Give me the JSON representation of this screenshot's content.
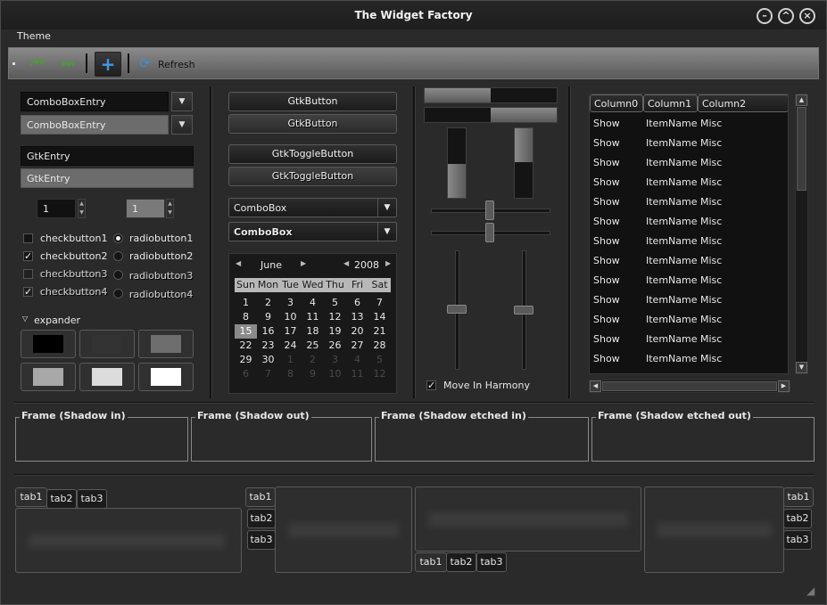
{
  "window": {
    "title": "The Widget Factory"
  },
  "menubar": {
    "theme_label": "Theme"
  },
  "toolbar": {
    "refresh_label": "Refresh"
  },
  "left": {
    "combo_entry_1": "ComboBoxEntry",
    "combo_entry_2": "ComboBoxEntry",
    "entry_1": "GtkEntry",
    "entry_2": "GtkEntry",
    "spin_1": "1",
    "spin_2": "1",
    "checks": [
      {
        "label": "checkbutton1",
        "checked": false
      },
      {
        "label": "checkbutton2",
        "checked": true
      },
      {
        "label": "checkbutton3",
        "checked": false
      },
      {
        "label": "checkbutton4",
        "checked": false
      }
    ],
    "radios": [
      {
        "label": "radiobutton1",
        "selected": true
      },
      {
        "label": "radiobutton2",
        "selected": false
      },
      {
        "label": "radiobutton3",
        "selected": false
      },
      {
        "label": "radiobutton4",
        "selected": false
      }
    ],
    "expander_label": "expander",
    "swatches": [
      "#000000",
      "#333333",
      "#6e6e6e",
      "#a8a8a8",
      "#dcdcdc",
      "#ffffff"
    ]
  },
  "middle": {
    "button_1": "GtkButton",
    "button_2": "GtkButton",
    "toggle_1": "GtkToggleButton",
    "toggle_2": "GtkToggleButton",
    "combo_1": "ComboBox",
    "combo_2": "ComboBox",
    "calendar": {
      "month": "June",
      "year": "2008",
      "day_names": [
        "Sun",
        "Mon",
        "Tue",
        "Wed",
        "Thu",
        "Fri",
        "Sat"
      ],
      "days": [
        "1",
        "2",
        "3",
        "4",
        "5",
        "6",
        "7",
        "8",
        "9",
        "10",
        "11",
        "12",
        "13",
        "14",
        "15",
        "16",
        "17",
        "18",
        "19",
        "20",
        "21",
        "22",
        "23",
        "24",
        "25",
        "26",
        "27",
        "28",
        "29",
        "30",
        "1",
        "2",
        "3",
        "4",
        "5",
        "6",
        "7",
        "8",
        "9",
        "10",
        "11",
        "12"
      ],
      "selected_day": "15"
    }
  },
  "sliders": {
    "harmony_label": "Move In Harmony",
    "harmony_checked": true
  },
  "tree": {
    "columns": [
      "Column0",
      "Column1",
      "Column2"
    ],
    "rows": [
      [
        "Show",
        "ItemName",
        "Misc"
      ],
      [
        "Show",
        "ItemName",
        "Misc"
      ],
      [
        "Show",
        "ItemName",
        "Misc"
      ],
      [
        "Show",
        "ItemName",
        "Misc"
      ],
      [
        "Show",
        "ItemName",
        "Misc"
      ],
      [
        "Show",
        "ItemName",
        "Misc"
      ],
      [
        "Show",
        "ItemName",
        "Misc"
      ],
      [
        "Show",
        "ItemName",
        "Misc"
      ],
      [
        "Show",
        "ItemName",
        "Misc"
      ],
      [
        "Show",
        "ItemName",
        "Misc"
      ],
      [
        "Show",
        "ItemName",
        "Misc"
      ],
      [
        "Show",
        "ItemName",
        "Misc"
      ],
      [
        "Show",
        "ItemName",
        "Misc"
      ]
    ]
  },
  "frames": [
    "Frame (Shadow in)",
    "Frame (Shadow out)",
    "Frame (Shadow etched in)",
    "Frame (Shadow etched out)"
  ],
  "tabs": [
    "tab1",
    "tab2",
    "tab3"
  ]
}
